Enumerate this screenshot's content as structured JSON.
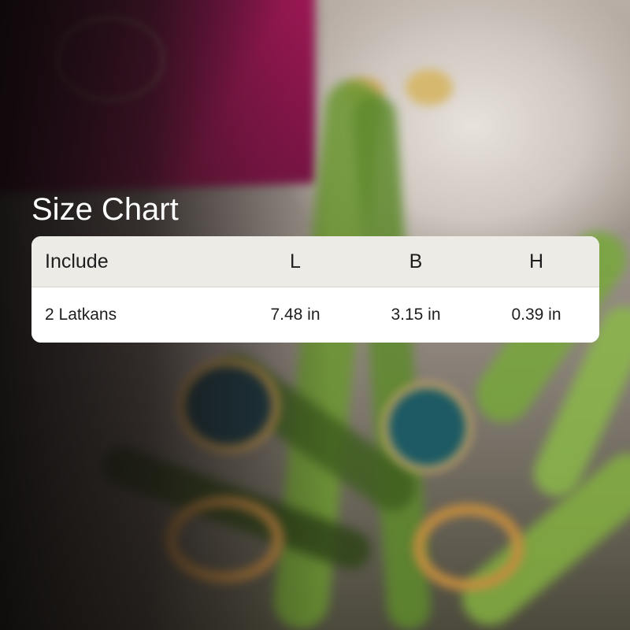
{
  "size_chart": {
    "title": "Size Chart",
    "columns": [
      "Include",
      "L",
      "B",
      "H"
    ],
    "rows": [
      [
        "2 Latkans",
        "7.48 in",
        "3.15 in",
        "0.39 in"
      ]
    ]
  }
}
